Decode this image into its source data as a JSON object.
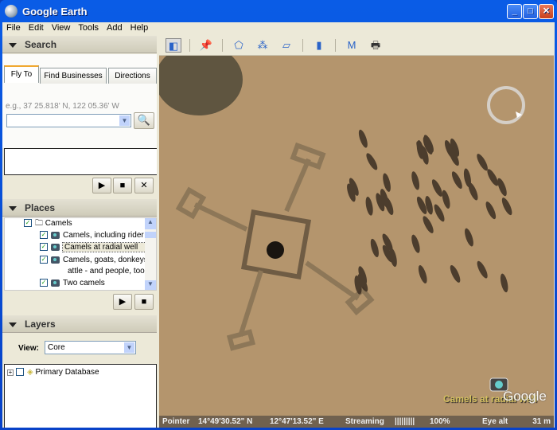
{
  "window": {
    "title": "Google Earth",
    "min": "_",
    "max": "□",
    "close": "✕"
  },
  "menu": [
    "File",
    "Edit",
    "View",
    "Tools",
    "Add",
    "Help"
  ],
  "search": {
    "header": "Search",
    "tabs": [
      "Fly To",
      "Find Businesses",
      "Directions"
    ],
    "hint": "e.g., 37 25.818' N, 122 05.36' W",
    "input_value": ""
  },
  "places": {
    "header": "Places",
    "folder": "Camels",
    "items": [
      "Camels, including rider",
      "Camels at radial well",
      "Camels, goats, donkeys",
      "attle - and people, too!",
      "Two camels"
    ]
  },
  "layers": {
    "header": "Layers",
    "view_label": "View:",
    "view_value": "Core",
    "items": [
      "Primary Database"
    ]
  },
  "map": {
    "placemark_label": "Camels at radial well",
    "watermark": "Google"
  },
  "status": {
    "pointer_label": "Pointer",
    "lat": "14°49'30.52\" N",
    "lon": "12°47'13.52\" E",
    "streaming_label": "Streaming",
    "streaming_bar": "|||||||||",
    "streaming_pct": "100%",
    "eye_label": "Eye alt",
    "eye_value": "31 m"
  },
  "colors": {
    "titlebar": "#0a5ce6",
    "sand": "#b4956d"
  }
}
